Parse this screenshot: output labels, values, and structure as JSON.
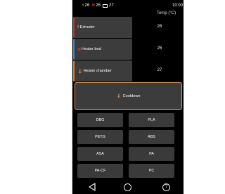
{
  "status": {
    "nozzle_temp": "26",
    "bed_temp": "25",
    "chamber_temp": "27",
    "time": "10:00"
  },
  "table": {
    "temp_header": "Temp (°C)"
  },
  "heaters": [
    {
      "label": "Extruder",
      "temp": "26",
      "accent": "#c8322b",
      "icon": "nozzle-icon"
    },
    {
      "label": "Heater bed",
      "temp": "25",
      "accent": "#2a8fd6",
      "icon": "heater-bed-icon"
    },
    {
      "label": "Heater chamber",
      "temp": "27",
      "accent": "#e07a2a",
      "icon": "thermometer-icon"
    }
  ],
  "cooldown": {
    "label": "Cooldown",
    "border_color": "#e09a57"
  },
  "presets": [
    "DBG",
    "PLA",
    "PETG",
    "ABS",
    "ASA",
    "PA",
    "PA-CF",
    "PC"
  ],
  "colors": {
    "background": "#000000",
    "button": "#3c3c3c"
  },
  "nav": {
    "help_glyph": "?"
  }
}
